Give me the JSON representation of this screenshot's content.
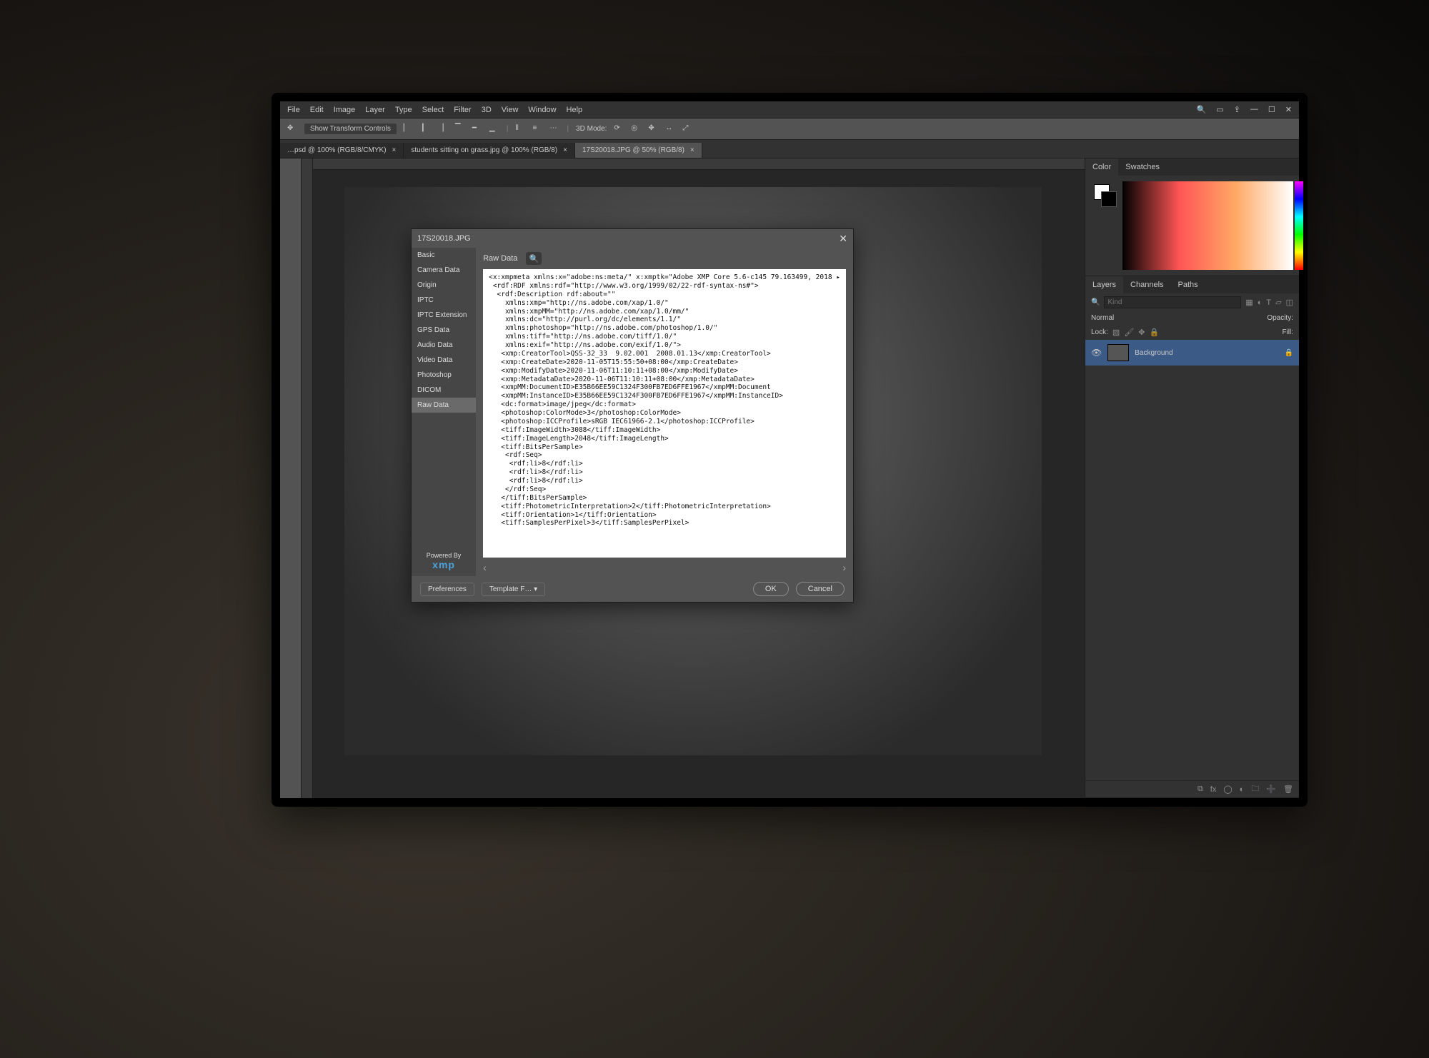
{
  "menubar": {
    "items": [
      "File",
      "Edit",
      "Image",
      "Layer",
      "Type",
      "Select",
      "Filter",
      "3D",
      "View",
      "Window",
      "Help"
    ]
  },
  "optbar": {
    "show_transform": "Show Transform Controls",
    "mode_label": "3D Mode:"
  },
  "tabs": [
    {
      "label": "…psd @ 100% (RGB/8/CMYK)"
    },
    {
      "label": "students sitting on grass.jpg @ 100% (RGB/8)"
    },
    {
      "label": "17S20018.JPG @ 50% (RGB/8)"
    }
  ],
  "panels": {
    "color_tabs": [
      "Color",
      "Swatches"
    ],
    "layers_tabs": [
      "Layers",
      "Channels",
      "Paths"
    ],
    "layers_filter_placeholder": "Kind",
    "blend": "Normal",
    "opacity_label": "Opacity:",
    "lock_label": "Lock:",
    "fill_label": "Fill:",
    "layer_name": "Background"
  },
  "dialog": {
    "title": "17S20018.JPG",
    "categories": [
      "Basic",
      "Camera Data",
      "Origin",
      "IPTC",
      "IPTC Extension",
      "GPS Data",
      "Audio Data",
      "Video Data",
      "Photoshop",
      "DICOM",
      "Raw Data"
    ],
    "active_category": 10,
    "content_header": "Raw Data",
    "powered_by": "Powered By",
    "powered_brand": "xmp",
    "preferences": "Preferences",
    "template": "Template F…",
    "ok": "OK",
    "cancel": "Cancel",
    "raw_lines": [
      "<x:xmpmeta xmlns:x=\"adobe:ns:meta/\" x:xmptk=\"Adobe XMP Core 5.6-c145 79.163499, 2018 ▸",
      " <rdf:RDF xmlns:rdf=\"http://www.w3.org/1999/02/22-rdf-syntax-ns#\">",
      "  <rdf:Description rdf:about=\"\"",
      "    xmlns:xmp=\"http://ns.adobe.com/xap/1.0/\"",
      "    xmlns:xmpMM=\"http://ns.adobe.com/xap/1.0/mm/\"",
      "    xmlns:dc=\"http://purl.org/dc/elements/1.1/\"",
      "    xmlns:photoshop=\"http://ns.adobe.com/photoshop/1.0/\"",
      "    xmlns:tiff=\"http://ns.adobe.com/tiff/1.0/\"",
      "    xmlns:exif=\"http://ns.adobe.com/exif/1.0/\">",
      "   <xmp:CreatorTool>QSS-32_33  9.02.001  2008.01.13</xmp:CreatorTool>",
      "   <xmp:CreateDate>2020-11-05T15:55:50+08:00</xmp:CreateDate>",
      "   <xmp:ModifyDate>2020-11-06T11:10:11+08:00</xmp:ModifyDate>",
      "   <xmp:MetadataDate>2020-11-06T11:10:11+08:00</xmp:MetadataDate>",
      "   <xmpMM:DocumentID>E35B66EE59C1324F300FB7ED6FFE1967</xmpMM:Document",
      "   <xmpMM:InstanceID>E35B66EE59C1324F300FB7ED6FFE1967</xmpMM:InstanceID>",
      "   <dc:format>image/jpeg</dc:format>",
      "   <photoshop:ColorMode>3</photoshop:ColorMode>",
      "   <photoshop:ICCProfile>sRGB IEC61966-2.1</photoshop:ICCProfile>",
      "   <tiff:ImageWidth>3088</tiff:ImageWidth>",
      "   <tiff:ImageLength>2048</tiff:ImageLength>",
      "   <tiff:BitsPerSample>",
      "    <rdf:Seq>",
      "     <rdf:li>8</rdf:li>",
      "     <rdf:li>8</rdf:li>",
      "     <rdf:li>8</rdf:li>",
      "    </rdf:Seq>",
      "   </tiff:BitsPerSample>",
      "   <tiff:PhotometricInterpretation>2</tiff:PhotometricInterpretation>",
      "   <tiff:Orientation>1</tiff:Orientation>",
      "   <tiff:SamplesPerPixel>3</tiff:SamplesPerPixel>"
    ]
  }
}
